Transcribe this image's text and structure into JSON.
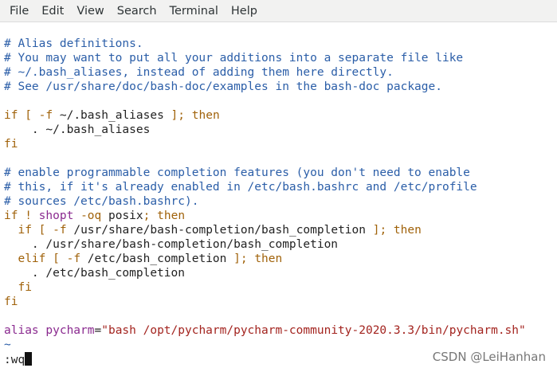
{
  "menu": {
    "file": "File",
    "edit": "Edit",
    "view": "View",
    "search": "Search",
    "terminal": "Terminal",
    "help": "Help"
  },
  "editor": {
    "lines": [
      {
        "text": "# Alias definitions.",
        "kind": "comment"
      },
      {
        "text": "# You may want to put all your additions into a separate file like",
        "kind": "comment"
      },
      {
        "text": "# ~/.bash_aliases, instead of adding them here directly.",
        "kind": "comment"
      },
      {
        "text": "# See /usr/share/doc/bash-doc/examples in the bash-doc package.",
        "kind": "comment"
      },
      {
        "text": "",
        "kind": "blank"
      },
      {
        "text": "if [ -f ~/.bash_aliases ]; then",
        "kind": "code"
      },
      {
        "text": "    . ~/.bash_aliases",
        "kind": "code"
      },
      {
        "text": "fi",
        "kind": "code"
      },
      {
        "text": "",
        "kind": "blank"
      },
      {
        "text": "# enable programmable completion features (you don't need to enable",
        "kind": "comment"
      },
      {
        "text": "# this, if it's already enabled in /etc/bash.bashrc and /etc/profile",
        "kind": "comment"
      },
      {
        "text": "# sources /etc/bash.bashrc).",
        "kind": "comment"
      },
      {
        "text": "if ! shopt -oq posix; then",
        "kind": "code"
      },
      {
        "text": "  if [ -f /usr/share/bash-completion/bash_completion ]; then",
        "kind": "code"
      },
      {
        "text": "    . /usr/share/bash-completion/bash_completion",
        "kind": "code"
      },
      {
        "text": "  elif [ -f /etc/bash_completion ]; then",
        "kind": "code"
      },
      {
        "text": "    . /etc/bash_completion",
        "kind": "code"
      },
      {
        "text": "  fi",
        "kind": "code"
      },
      {
        "text": "fi",
        "kind": "code"
      },
      {
        "text": "",
        "kind": "blank"
      },
      {
        "text": "alias pycharm=\"bash /opt/pycharm/pycharm-community-2020.3.3/bin/pycharm.sh\"",
        "kind": "code"
      },
      {
        "text": "~",
        "kind": "tilde"
      }
    ],
    "command_line": ":wq"
  },
  "watermark": "CSDN @LeiHanhan",
  "colors": {
    "comment": "#2b5ea8",
    "keyword": "#a0620a",
    "builtin": "#8a2a8f",
    "string": "#a3241f"
  }
}
